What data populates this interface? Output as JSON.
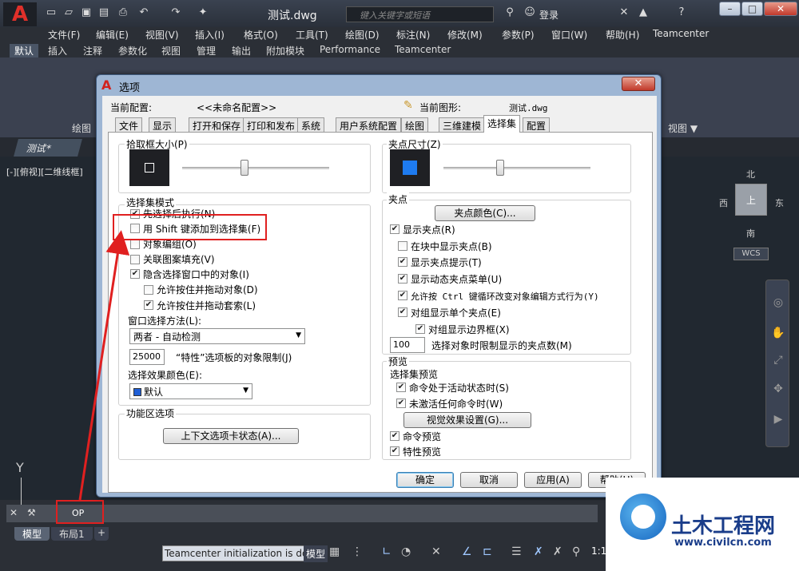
{
  "app": {
    "document_title": "测试.dwg",
    "search_placeholder": "键入关键字或短语",
    "login_label": "登录",
    "menus": [
      "文件(F)",
      "编辑(E)",
      "视图(V)",
      "插入(I)",
      "格式(O)",
      "工具(T)",
      "绘图(D)",
      "标注(N)",
      "修改(M)",
      "参数(P)",
      "窗口(W)",
      "帮助(H)",
      "Teamcenter"
    ],
    "ribbon_tabs": [
      "默认",
      "插入",
      "注释",
      "参数化",
      "视图",
      "管理",
      "输出",
      "附加模块",
      "Performance",
      "Teamcenter"
    ],
    "ribbon_panel_draw": "绘图",
    "ribbon_panel_view": "视图 ▼",
    "file_tab": "测试*",
    "view_label": "[-][俯视][二维线框]",
    "viewcube_top": "上",
    "compass": {
      "n": "北",
      "s": "南",
      "w": "西",
      "e": "东"
    },
    "wcs": "WCS",
    "ucs_y": "Y",
    "command_text": "OP",
    "layout_tabs": [
      "模型",
      "布局1",
      "+"
    ],
    "status_message": "Teamcenter initialization is done",
    "status_model": "模型",
    "status_scale": "1:1"
  },
  "dialog": {
    "title": "选项",
    "current_profile_label": "当前配置:",
    "current_profile_value": "<<未命名配置>>",
    "current_drawing_label": "当前图形:",
    "current_drawing_value": "测试.dwg",
    "tabs": [
      "文件",
      "显示",
      "打开和保存",
      "打印和发布",
      "系统",
      "用户系统配置",
      "绘图",
      "三维建模",
      "选择集",
      "配置"
    ],
    "active_tab": "选择集",
    "pickbox": {
      "title": "拾取框大小(P)",
      "slider_fraction": 0.42
    },
    "grip_size": {
      "title": "夹点尺寸(Z)",
      "slider_fraction": 0.38
    },
    "selection_modes": {
      "title": "选择集模式",
      "noun_verb": {
        "label": "先选择后执行(N)",
        "checked": true
      },
      "shift_add": {
        "label": "用 Shift 键添加到选择集(F)",
        "checked": false
      },
      "object_group": {
        "label": "对象编组(O)",
        "checked": false
      },
      "assoc_hatch": {
        "label": "关联图案填充(V)",
        "checked": false
      },
      "implied_window": {
        "label": "隐含选择窗口中的对象(I)",
        "checked": true
      },
      "press_drag_obj": {
        "label": "允许按住并拖动对象(D)",
        "checked": false
      },
      "press_drag_lasso": {
        "label": "允许按住并拖动套索(L)",
        "checked": true
      },
      "window_method_label": "窗口选择方法(L):",
      "window_method_value": "两者 - 自动检测",
      "limit_value": "25000",
      "limit_label": "“特性”选项板的对象限制(J)",
      "effect_color_label": "选择效果颜色(E):",
      "effect_color_value": "默认",
      "effect_color_swatch": "#1f5fd6"
    },
    "ribbon_options": {
      "title": "功能区选项",
      "button": "上下文选项卡状态(A)..."
    },
    "grips": {
      "title": "夹点",
      "color_button": "夹点颜色(C)...",
      "show_grips": {
        "label": "显示夹点(R)",
        "checked": true
      },
      "in_blocks": {
        "label": "在块中显示夹点(B)",
        "checked": false
      },
      "grip_tips": {
        "label": "显示夹点提示(T)",
        "checked": true
      },
      "dyn_menu": {
        "label": "显示动态夹点菜单(U)",
        "checked": true
      },
      "ctrl_cycle": {
        "label": "允许按 Ctrl 键循环改变对象编辑方式行为(Y)",
        "checked": true
      },
      "single_group": {
        "label": "对组显示单个夹点(E)",
        "checked": true
      },
      "group_bbox": {
        "label": "对组显示边界框(X)",
        "checked": true
      },
      "limit_value": "100",
      "limit_label": "选择对象时限制显示的夹点数(M)",
      "grip_color": "#1e7bf0"
    },
    "preview": {
      "title": "预览",
      "sub_title": "选择集预览",
      "cmd_active": {
        "label": "命令处于活动状态时(S)",
        "checked": true
      },
      "no_cmd": {
        "label": "未激活任何命令时(W)",
        "checked": true
      },
      "visual_button": "视觉效果设置(G)...",
      "cmd_preview": {
        "label": "命令预览",
        "checked": true
      },
      "prop_preview": {
        "label": "特性预览",
        "checked": true
      }
    },
    "buttons": {
      "ok": "确定",
      "cancel": "取消",
      "apply": "应用(A)",
      "help": "帮助(H)"
    }
  },
  "watermark": {
    "title": "土木工程网",
    "url": "www.civilcn.com"
  }
}
